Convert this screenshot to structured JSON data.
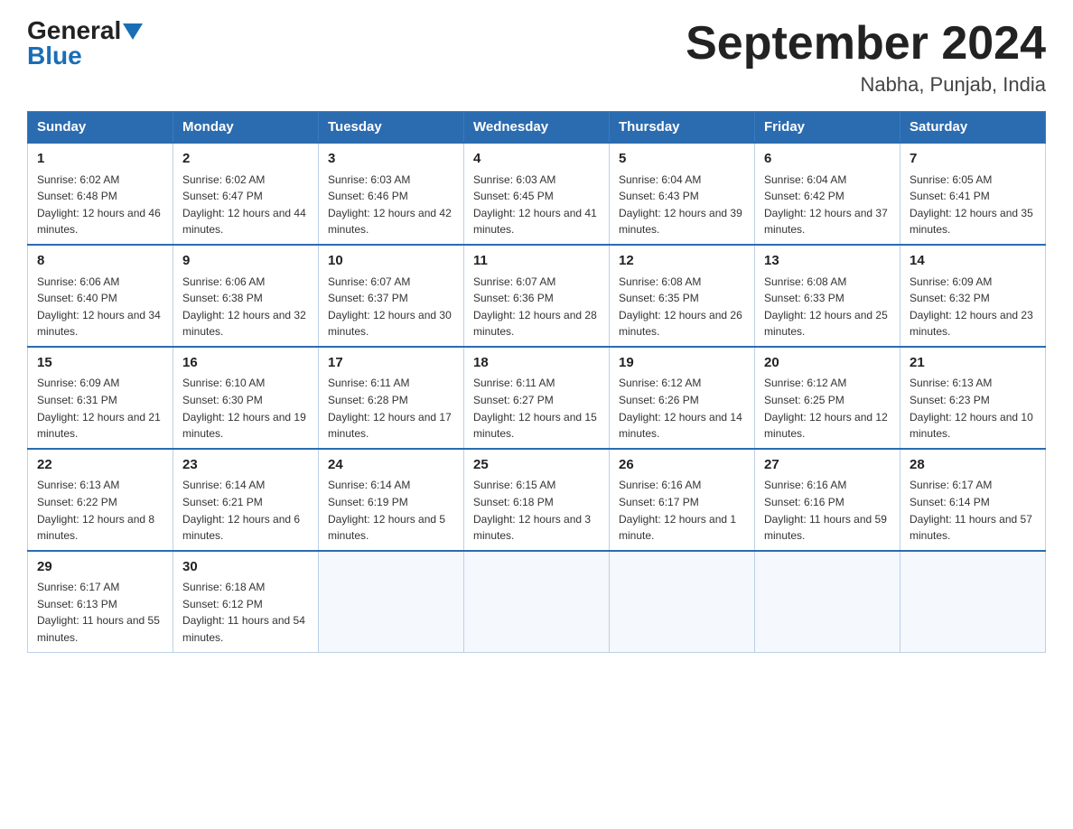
{
  "header": {
    "logo_general": "General",
    "logo_blue": "Blue",
    "title": "September 2024",
    "subtitle": "Nabha, Punjab, India"
  },
  "columns": [
    "Sunday",
    "Monday",
    "Tuesday",
    "Wednesday",
    "Thursday",
    "Friday",
    "Saturday"
  ],
  "weeks": [
    [
      {
        "day": "1",
        "sunrise": "6:02 AM",
        "sunset": "6:48 PM",
        "daylight": "12 hours and 46 minutes."
      },
      {
        "day": "2",
        "sunrise": "6:02 AM",
        "sunset": "6:47 PM",
        "daylight": "12 hours and 44 minutes."
      },
      {
        "day": "3",
        "sunrise": "6:03 AM",
        "sunset": "6:46 PM",
        "daylight": "12 hours and 42 minutes."
      },
      {
        "day": "4",
        "sunrise": "6:03 AM",
        "sunset": "6:45 PM",
        "daylight": "12 hours and 41 minutes."
      },
      {
        "day": "5",
        "sunrise": "6:04 AM",
        "sunset": "6:43 PM",
        "daylight": "12 hours and 39 minutes."
      },
      {
        "day": "6",
        "sunrise": "6:04 AM",
        "sunset": "6:42 PM",
        "daylight": "12 hours and 37 minutes."
      },
      {
        "day": "7",
        "sunrise": "6:05 AM",
        "sunset": "6:41 PM",
        "daylight": "12 hours and 35 minutes."
      }
    ],
    [
      {
        "day": "8",
        "sunrise": "6:06 AM",
        "sunset": "6:40 PM",
        "daylight": "12 hours and 34 minutes."
      },
      {
        "day": "9",
        "sunrise": "6:06 AM",
        "sunset": "6:38 PM",
        "daylight": "12 hours and 32 minutes."
      },
      {
        "day": "10",
        "sunrise": "6:07 AM",
        "sunset": "6:37 PM",
        "daylight": "12 hours and 30 minutes."
      },
      {
        "day": "11",
        "sunrise": "6:07 AM",
        "sunset": "6:36 PM",
        "daylight": "12 hours and 28 minutes."
      },
      {
        "day": "12",
        "sunrise": "6:08 AM",
        "sunset": "6:35 PM",
        "daylight": "12 hours and 26 minutes."
      },
      {
        "day": "13",
        "sunrise": "6:08 AM",
        "sunset": "6:33 PM",
        "daylight": "12 hours and 25 minutes."
      },
      {
        "day": "14",
        "sunrise": "6:09 AM",
        "sunset": "6:32 PM",
        "daylight": "12 hours and 23 minutes."
      }
    ],
    [
      {
        "day": "15",
        "sunrise": "6:09 AM",
        "sunset": "6:31 PM",
        "daylight": "12 hours and 21 minutes."
      },
      {
        "day": "16",
        "sunrise": "6:10 AM",
        "sunset": "6:30 PM",
        "daylight": "12 hours and 19 minutes."
      },
      {
        "day": "17",
        "sunrise": "6:11 AM",
        "sunset": "6:28 PM",
        "daylight": "12 hours and 17 minutes."
      },
      {
        "day": "18",
        "sunrise": "6:11 AM",
        "sunset": "6:27 PM",
        "daylight": "12 hours and 15 minutes."
      },
      {
        "day": "19",
        "sunrise": "6:12 AM",
        "sunset": "6:26 PM",
        "daylight": "12 hours and 14 minutes."
      },
      {
        "day": "20",
        "sunrise": "6:12 AM",
        "sunset": "6:25 PM",
        "daylight": "12 hours and 12 minutes."
      },
      {
        "day": "21",
        "sunrise": "6:13 AM",
        "sunset": "6:23 PM",
        "daylight": "12 hours and 10 minutes."
      }
    ],
    [
      {
        "day": "22",
        "sunrise": "6:13 AM",
        "sunset": "6:22 PM",
        "daylight": "12 hours and 8 minutes."
      },
      {
        "day": "23",
        "sunrise": "6:14 AM",
        "sunset": "6:21 PM",
        "daylight": "12 hours and 6 minutes."
      },
      {
        "day": "24",
        "sunrise": "6:14 AM",
        "sunset": "6:19 PM",
        "daylight": "12 hours and 5 minutes."
      },
      {
        "day": "25",
        "sunrise": "6:15 AM",
        "sunset": "6:18 PM",
        "daylight": "12 hours and 3 minutes."
      },
      {
        "day": "26",
        "sunrise": "6:16 AM",
        "sunset": "6:17 PM",
        "daylight": "12 hours and 1 minute."
      },
      {
        "day": "27",
        "sunrise": "6:16 AM",
        "sunset": "6:16 PM",
        "daylight": "11 hours and 59 minutes."
      },
      {
        "day": "28",
        "sunrise": "6:17 AM",
        "sunset": "6:14 PM",
        "daylight": "11 hours and 57 minutes."
      }
    ],
    [
      {
        "day": "29",
        "sunrise": "6:17 AM",
        "sunset": "6:13 PM",
        "daylight": "11 hours and 55 minutes."
      },
      {
        "day": "30",
        "sunrise": "6:18 AM",
        "sunset": "6:12 PM",
        "daylight": "11 hours and 54 minutes."
      },
      null,
      null,
      null,
      null,
      null
    ]
  ]
}
